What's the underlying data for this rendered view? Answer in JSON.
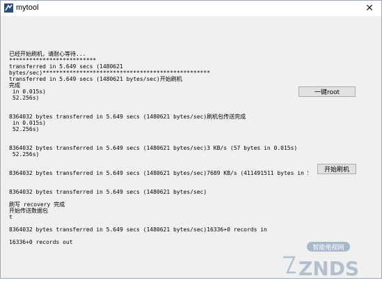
{
  "window": {
    "title": "mytool",
    "close_glyph": "✕",
    "icon": "app-icon"
  },
  "log": {
    "lines": [
      "已经开始刷机，请耐心等待...",
      "**************************",
      "transferred in 5.649 secs (1480621",
      "bytes/sec)**************************************************",
      "transferred in 5.649 secs (1480621 bytes/sec)开始刷机",
      "完成",
      " in 0.015s)",
      " 52.256s)",
      "",
      "",
      "8364032 bytes transferred in 5.649 secs (1480621 bytes/sec)刷机包传送完成",
      " in 0.015s)",
      " 52.256s)",
      "",
      "",
      "8364032 bytes transferred in 5.649 secs (1480621 bytes/sec)3 KB/s (57 bytes in 0.015s)",
      " 52.256s)",
      "",
      "",
      "8364032 bytes transferred in 5.649 secs (1480621 bytes/sec)7689 KB/s (411491511 bytes in 52.256s)",
      "",
      "",
      "8364032 bytes transferred in 5.649 secs (1480621 bytes/sec)",
      "",
      "刷写 recovery 完成",
      "开始传送数据包",
      "t",
      "",
      "8364032 bytes transferred in 5.649 secs (1480621 bytes/sec)16336+0 records in",
      "",
      "16336+0 records out"
    ]
  },
  "buttons": {
    "root": "一键root",
    "flash": "开始刷机"
  },
  "watermark": {
    "brand": "ZNDS",
    "subtitle": "智能电视网"
  }
}
